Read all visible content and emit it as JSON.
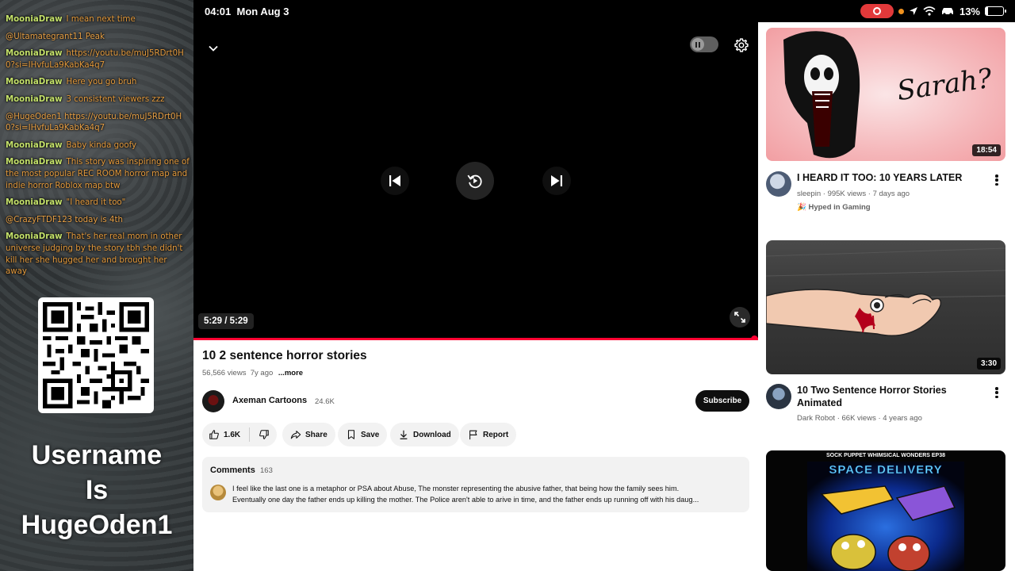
{
  "status_bar": {
    "time": "04:01",
    "date": "Mon Aug 3",
    "battery": "13%",
    "battery_level": 0.13
  },
  "chat": [
    {
      "user": "MooniaDraw",
      "text": "I mean next time"
    },
    {
      "user": "",
      "text": "@Ultamategrant11 Peak"
    },
    {
      "user": "MooniaDraw",
      "text": "https://youtu.be/muJ5RDrt0H0?si=IHvfuLa9KabKa4q7"
    },
    {
      "user": "MooniaDraw",
      "text": "Here you go bruh"
    },
    {
      "user": "MooniaDraw",
      "text": "3 consistent viewers zzz"
    },
    {
      "user": "",
      "text": "@HugeOden1 https://youtu.be/muJ5RDrt0H0?si=IHvfuLa9KabKa4q7"
    },
    {
      "user": "MooniaDraw",
      "text": "Baby kinda goofy"
    },
    {
      "user": "MooniaDraw",
      "text": "This story was inspiring one of the most popular REC ROOM horror map and indie horror Roblox map btw"
    },
    {
      "user": "MooniaDraw",
      "text": "\"I heard it too\""
    },
    {
      "user": "",
      "text": "@CrazyFTDF123 today is 4th"
    },
    {
      "user": "MooniaDraw",
      "text": "That's her real mom in other universe judging by the story tbh she didn't kill her she hugged her and brought her away"
    }
  ],
  "overlay": {
    "line1": "Username",
    "line2": "Is",
    "line3": "HugeOden1"
  },
  "player": {
    "time_display": "5:29 / 5:29",
    "progress": 1.0
  },
  "video": {
    "title": "10 2 sentence horror stories",
    "views": "56,566 views",
    "age": "7y ago",
    "more": "...more",
    "channel": "Axeman Cartoons",
    "subscribers": "24.6K",
    "subscribe_label": "Subscribe",
    "likes": "1.6K",
    "share_label": "Share",
    "save_label": "Save",
    "download_label": "Download",
    "report_label": "Report"
  },
  "comments": {
    "label": "Comments",
    "count": "163",
    "line1": "I feel like the last one is a metaphor or PSA about Abuse, The monster representing the abusive father, that being how the family sees him.",
    "line2": "Eventually one day the father ends up killing the mother. The Police aren't able to arive in time, and the father ends up running off with his daug..."
  },
  "suggestions": [
    {
      "title": "I HEARD IT TOO: 10 YEARS LATER",
      "channel": "sleepin",
      "stats": "995K views · 7 days ago",
      "badge": "Hyped in Gaming",
      "duration": "18:54",
      "thumb_text": "Sarah?"
    },
    {
      "title": "10 Two Sentence Horror Stories Animated",
      "channel": "Dark Robot",
      "stats": "66K views · 4 years ago",
      "duration": "3:30"
    },
    {
      "thumb_caption": "SOCK PUPPET WHIMSICAL WONDERS EP38",
      "thumb_title": "SPACE DELIVERY"
    }
  ],
  "colors": {
    "accent": "#ff0033",
    "chat_user": "#c4e16a",
    "chat_text": "#e49a3c",
    "rec": "#e2393a"
  }
}
